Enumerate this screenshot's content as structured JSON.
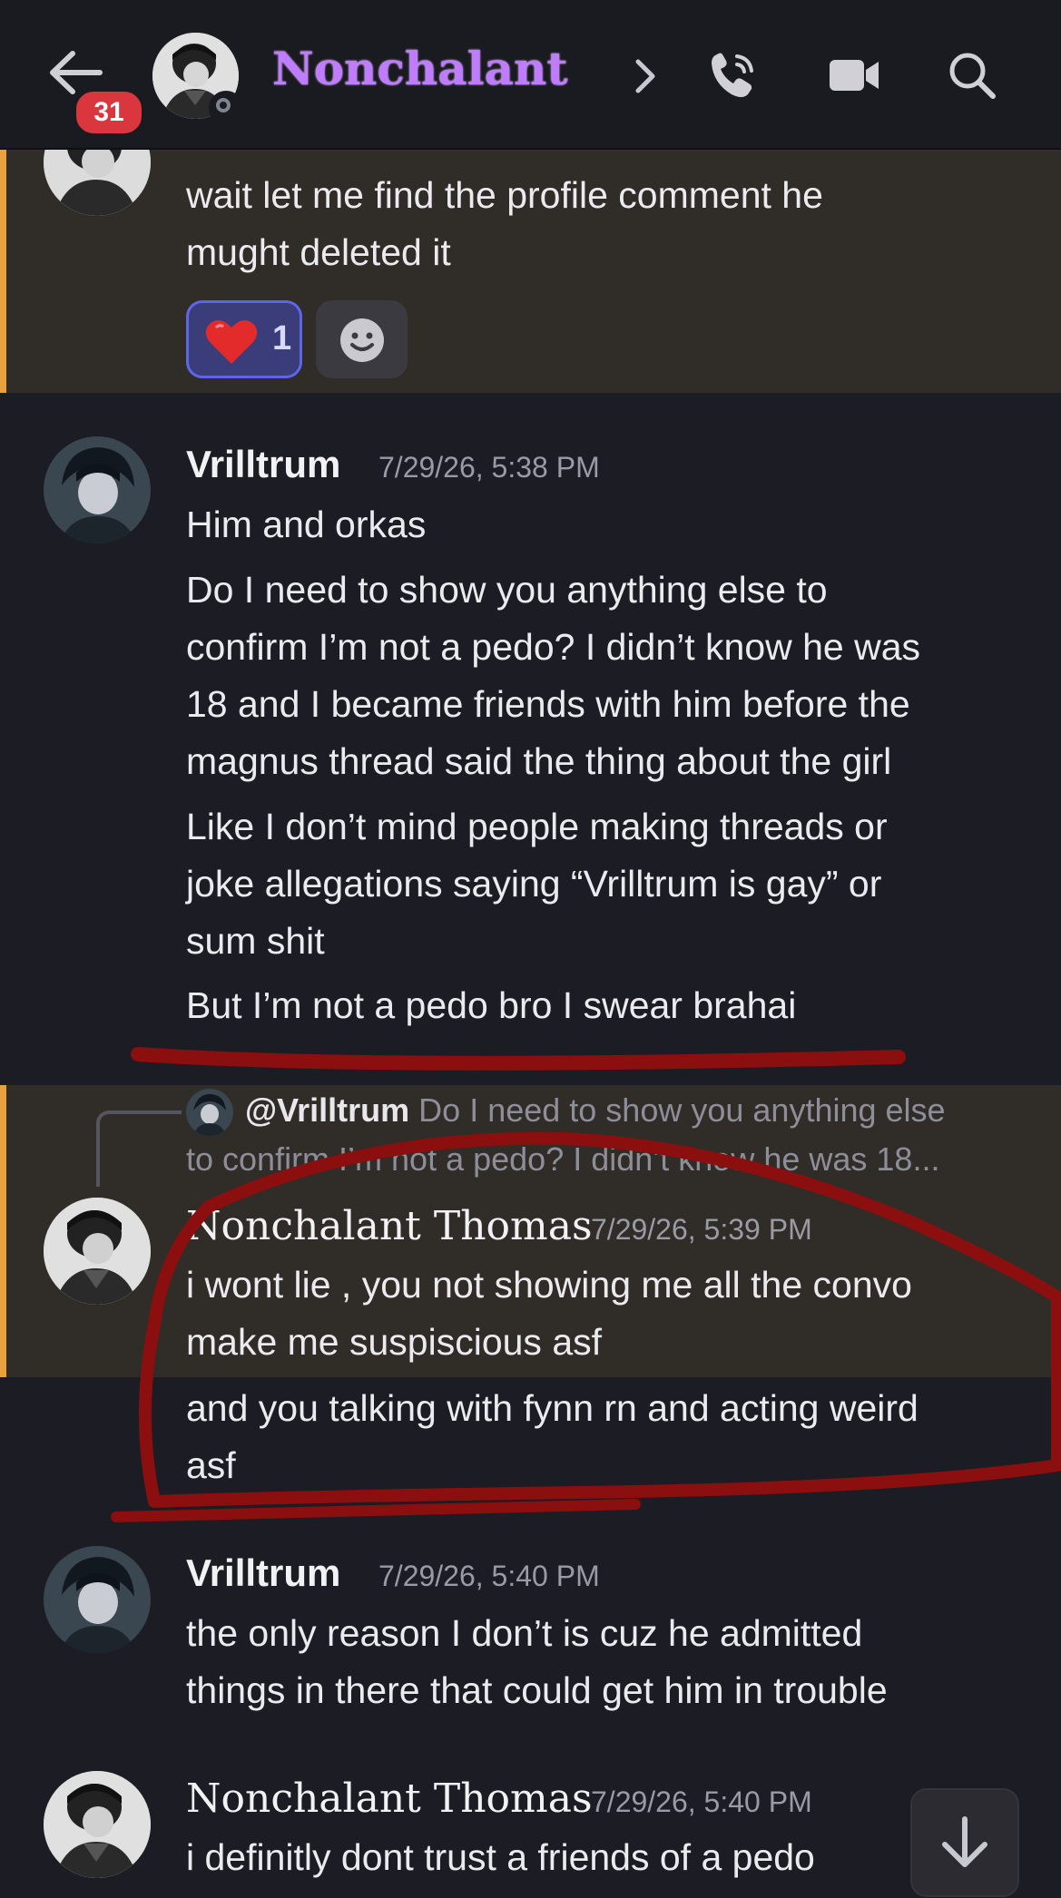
{
  "header": {
    "unread_count": "31",
    "channel_name": "Nonchalant",
    "icons": [
      "back-arrow-icon",
      "chevron-right-icon",
      "phone-call-icon",
      "video-camera-icon",
      "search-icon"
    ]
  },
  "messages": [
    {
      "author": "",
      "timestamp": "",
      "lines": [
        "wait let me find the profile comment he",
        "mught deleted it"
      ],
      "highlighted": true,
      "reactions": [
        {
          "emoji": "❤️",
          "count": "1"
        }
      ]
    },
    {
      "author": "Vrilltrum",
      "timestamp": "7/29/26, 5:38 PM",
      "paragraphs": [
        [
          "Him and orkas"
        ],
        [
          "Do I need to show you anything else to",
          "confirm I’m not a pedo? I didn’t know he was",
          "18 and I became friends with him before the",
          "magnus thread said the thing about the girl"
        ],
        [
          "Like I don’t mind people making threads or",
          "joke allegations saying “Vrilltrum is gay” or",
          "sum shit"
        ],
        [
          "But I’m not a pedo bro I swear brahai"
        ]
      ]
    },
    {
      "reply_to": {
        "mention": "@Vrilltrum",
        "preview_line1": "Do I need to show you anything else",
        "preview_line2": "to confirm I’m not a pedo? I didn’t know he was 18..."
      },
      "author": "Nonchalant Thomas",
      "timestamp": "7/29/26, 5:39 PM",
      "lines": [
        "i wont lie , you not showing me all the convo",
        "make me suspiscious asf"
      ],
      "highlighted": true
    },
    {
      "author": "",
      "lines": [
        "and you talking with fynn rn and acting weird",
        "asf"
      ]
    },
    {
      "author": "Vrilltrum",
      "timestamp": "7/29/26, 5:40 PM",
      "lines": [
        "the only reason I don’t is cuz he admitted",
        "things in there that could get him in trouble"
      ]
    },
    {
      "author": "Nonchalant Thomas",
      "timestamp": "7/29/26, 5:40 PM",
      "lines": [
        "i definitly dont trust a friends of a pedo"
      ]
    }
  ],
  "colors": {
    "background": "#1c1c24",
    "highlight_bg": "#302c28",
    "highlight_bar": "#e9a23b",
    "channel_name": "#c07cff",
    "annotation": "#8b0f0f"
  }
}
